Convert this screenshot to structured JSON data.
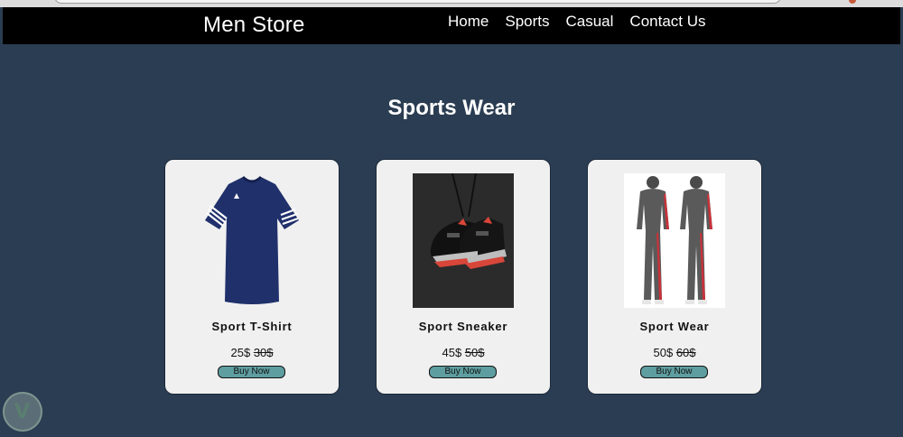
{
  "nav": {
    "brand": "Men Store",
    "links": [
      "Home",
      "Sports",
      "Casual",
      "Contact Us"
    ]
  },
  "section": {
    "title": "Sports Wear"
  },
  "products": [
    {
      "name": "Sport T-Shirt",
      "price": "25$",
      "old_price": "30$",
      "button": "Buy Now",
      "image": "tshirt-image"
    },
    {
      "name": "Sport Sneaker",
      "price": "45$",
      "old_price": "50$",
      "button": "Buy Now",
      "image": "sneaker-image"
    },
    {
      "name": "Sport Wear",
      "price": "50$",
      "old_price": "60$",
      "button": "Buy Now",
      "image": "tracksuit-image"
    }
  ],
  "colors": {
    "background": "#2b3d52",
    "navbar": "#000000",
    "card": "#f0f0f0",
    "button": "#5f9ea0"
  }
}
